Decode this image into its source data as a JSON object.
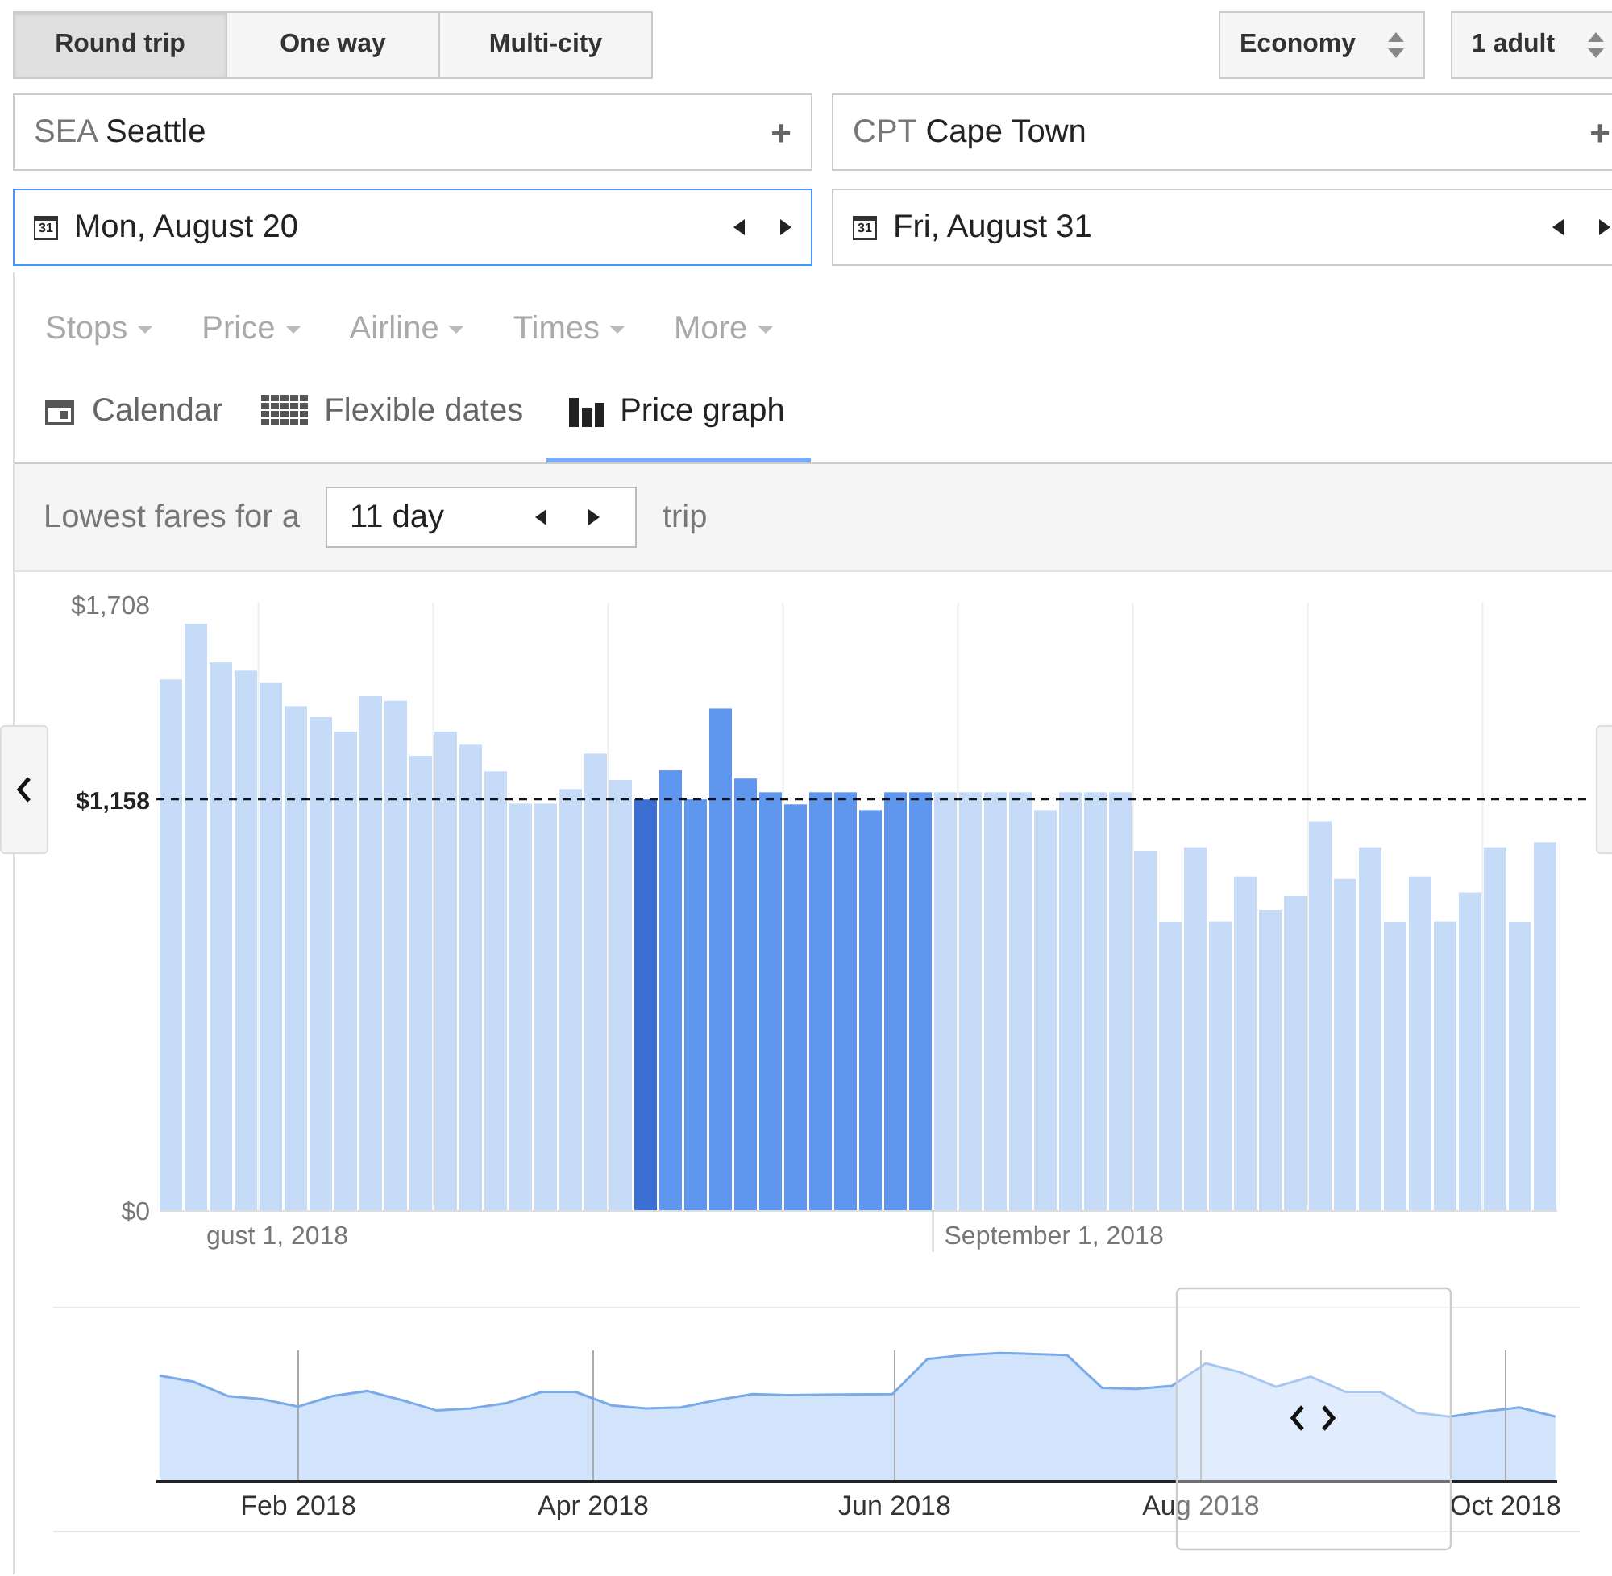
{
  "trip_types": [
    {
      "label": "Round trip",
      "selected": true
    },
    {
      "label": "One way",
      "selected": false
    },
    {
      "label": "Multi-city",
      "selected": false
    }
  ],
  "cabin_select": {
    "value": "Economy"
  },
  "passengers_select": {
    "value": "1 adult"
  },
  "origin": {
    "code": "SEA",
    "city": "Seattle",
    "action": "+"
  },
  "destination": {
    "code": "CPT",
    "city": "Cape Town",
    "action": "+"
  },
  "departure_date": {
    "icon_text": "31",
    "value": "Mon, August 20",
    "focused": true
  },
  "return_date": {
    "icon_text": "31",
    "value": "Fri, August 31",
    "focused": false
  },
  "filters": [
    "Stops",
    "Price",
    "Airline",
    "Times",
    "More"
  ],
  "views": [
    {
      "label": "Calendar",
      "kind": "calendar",
      "selected": false
    },
    {
      "label": "Flexible dates",
      "kind": "grid",
      "selected": false
    },
    {
      "label": "Price graph",
      "kind": "graph",
      "selected": true
    }
  ],
  "trip_length": {
    "prefix": "Lowest fares for a",
    "value": "11 day",
    "suffix": "trip"
  },
  "price_chart": {
    "date_labels": [
      "gust 1, 2018",
      "September 1, 2018"
    ],
    "chart_data": {
      "type": "bar",
      "stacked": true,
      "ylim": [
        0,
        1708
      ],
      "yticks": [
        {
          "value": 0,
          "label": "$0"
        },
        {
          "value": 1708,
          "label": "$1,708"
        }
      ],
      "ref_lines": [
        {
          "axis": "y",
          "value": 1158,
          "label": "$1,158"
        }
      ],
      "series": [
        {
          "color": "#c6dbf7",
          "values": [
            1496,
            1653,
            1544,
            1521,
            1486,
            1421,
            1390,
            1349,
            1449,
            1436,
            1281,
            1349,
            1312,
            1237,
            1146,
            1146,
            1187,
            1287,
            1213,
            null,
            null,
            null,
            null,
            null,
            null,
            null,
            null,
            null,
            null,
            null,
            null,
            1178,
            1178,
            1178,
            1178,
            1128,
            1178,
            1178,
            1178,
            1013,
            813,
            1023,
            814,
            941,
            845,
            886,
            1096,
            934,
            1023,
            813,
            941,
            814,
            896,
            1023,
            813,
            1037
          ]
        },
        {
          "color": "#3b6fd4",
          "values": [
            null,
            null,
            null,
            null,
            null,
            null,
            null,
            null,
            null,
            null,
            null,
            null,
            null,
            null,
            null,
            null,
            null,
            null,
            null,
            1158,
            null,
            null,
            null,
            null,
            null,
            null,
            null,
            null,
            null,
            null,
            null,
            null,
            null,
            null,
            null,
            null,
            null,
            null,
            null,
            null,
            null,
            null,
            null,
            null,
            null,
            null,
            null,
            null,
            null,
            null,
            null,
            null,
            null,
            null,
            null,
            null
          ]
        },
        {
          "color": "#5f97ef",
          "values": [
            null,
            null,
            null,
            null,
            null,
            null,
            null,
            null,
            null,
            null,
            null,
            null,
            null,
            null,
            null,
            null,
            null,
            null,
            null,
            null,
            1240,
            1158,
            1414,
            1217,
            1178,
            1144,
            1178,
            1178,
            1128,
            1178,
            1178,
            null,
            null,
            null,
            null,
            null,
            null,
            null,
            null,
            null,
            null,
            null,
            null,
            null,
            null,
            null,
            null,
            null,
            null,
            null,
            null,
            null,
            null,
            null,
            null,
            null
          ]
        }
      ]
    }
  },
  "overview": {
    "months": [
      "Feb 2018",
      "Apr 2018",
      "Jun 2018",
      "Aug 2018",
      "Oct 2018"
    ]
  }
}
